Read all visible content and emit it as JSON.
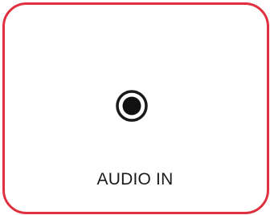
{
  "panel": {
    "border_color": "#e0303f",
    "jack_icon": "audio-jack-icon",
    "label": "AUDIO IN"
  }
}
